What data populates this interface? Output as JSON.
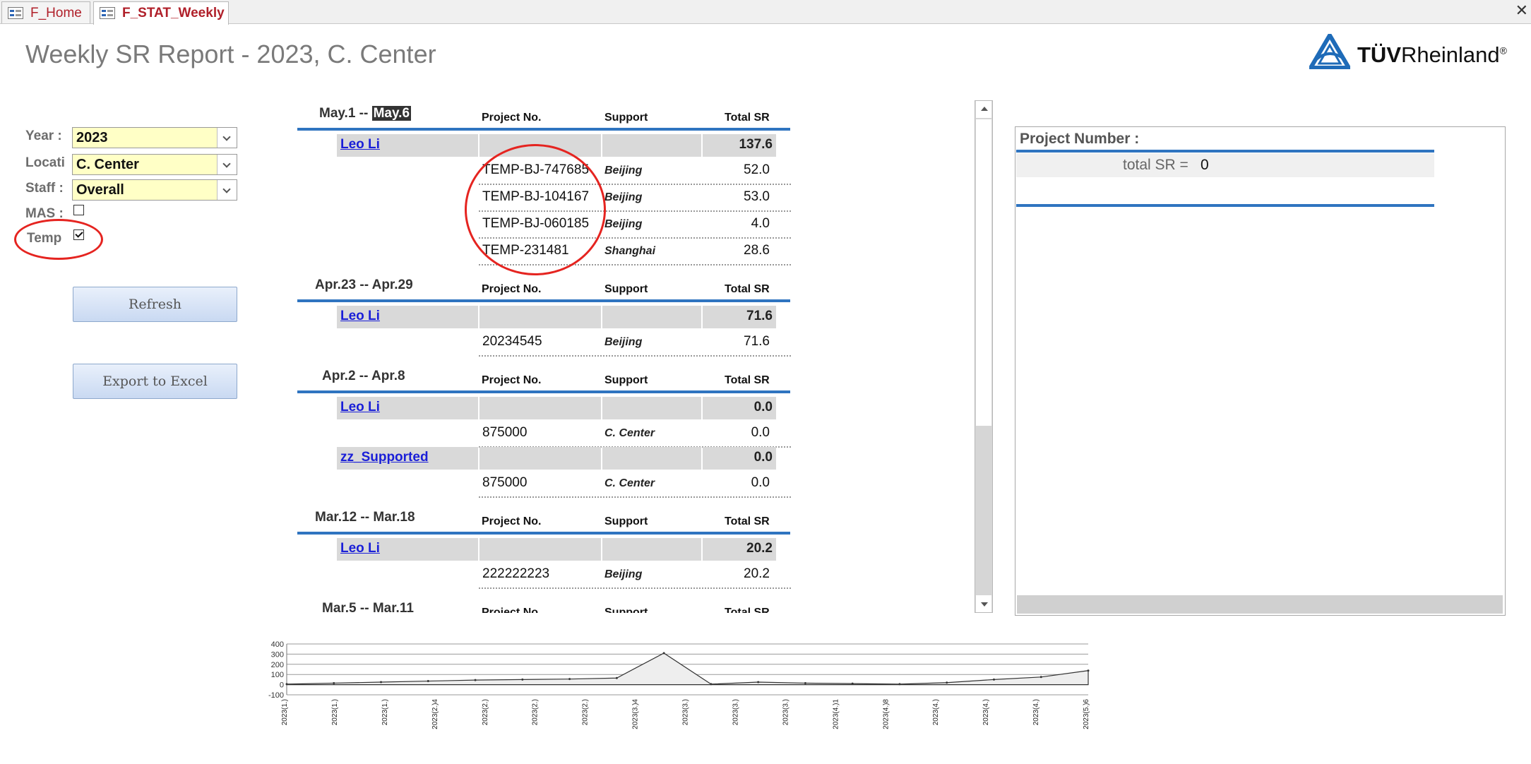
{
  "tabs": [
    {
      "label": "F_Home",
      "active": false
    },
    {
      "label": "F_STAT_Weekly",
      "active": true
    }
  ],
  "window": {
    "close_glyph": "✕"
  },
  "title": "Weekly SR Report - 2023, C. Center",
  "logo": {
    "text_bold": "TÜV",
    "text_regular": "Rheinland",
    "mark": "®",
    "icon": "tuv-triangle-icon"
  },
  "filters": {
    "year": {
      "label": "Year :",
      "value": "2023"
    },
    "location": {
      "label": "Locati",
      "value": "C. Center"
    },
    "staff": {
      "label": "Staff :",
      "value": "Overall"
    },
    "mas": {
      "label": "MAS :",
      "checked": false
    },
    "temp": {
      "label": "Temp",
      "checked": true
    }
  },
  "buttons": {
    "refresh": "Refresh",
    "export": "Export to Excel"
  },
  "report": {
    "columns": {
      "project": "Project No.",
      "support": "Support",
      "total": "Total SR"
    },
    "dash": "--",
    "weeks": [
      {
        "start": "May.1",
        "end": "May.6",
        "groups": [
          {
            "staff": "Leo Li",
            "total": "137.6",
            "rows": [
              {
                "project": "TEMP-BJ-747685",
                "support": "Beijing",
                "total": "52.0"
              },
              {
                "project": "TEMP-BJ-104167",
                "support": "Beijing",
                "total": "53.0"
              },
              {
                "project": "TEMP-BJ-060185",
                "support": "Beijing",
                "total": "4.0"
              },
              {
                "project": "TEMP-231481",
                "support": "Shanghai",
                "total": "28.6"
              }
            ]
          }
        ]
      },
      {
        "start": "Apr.23",
        "end": "Apr.29",
        "groups": [
          {
            "staff": "Leo Li",
            "total": "71.6",
            "rows": [
              {
                "project": "20234545",
                "support": "Beijing",
                "total": "71.6"
              }
            ]
          }
        ]
      },
      {
        "start": "Apr.2",
        "end": "Apr.8",
        "groups": [
          {
            "staff": "Leo Li",
            "total": "0.0",
            "rows": [
              {
                "project": "875000",
                "support": "C. Center",
                "total": "0.0"
              }
            ]
          },
          {
            "staff": "zz_Supported",
            "total": "0.0",
            "rows": [
              {
                "project": "875000",
                "support": "C. Center",
                "total": "0.0"
              }
            ]
          }
        ]
      },
      {
        "start": "Mar.12",
        "end": "Mar.18",
        "groups": [
          {
            "staff": "Leo Li",
            "total": "20.2",
            "rows": [
              {
                "project": "222222223",
                "support": "Beijing",
                "total": "20.2"
              }
            ]
          }
        ]
      },
      {
        "start": "Mar.5",
        "end": "Mar.11",
        "groups": []
      }
    ]
  },
  "detail": {
    "project_number_label": "Project Number :",
    "total_sr_label": "total SR =",
    "total_sr_value": "0"
  },
  "colors": {
    "accent_blue": "#2f74c0",
    "link": "#1a1fd8",
    "combo_bg": "#ffffc6",
    "annotation_red": "#e52420",
    "tab_text": "#b0202a"
  },
  "chart_data": {
    "type": "area",
    "ylim": [
      -100,
      400
    ],
    "yticks": [
      "400",
      "300",
      "200",
      "100",
      "0",
      "-100"
    ],
    "x": [
      "2023(1.)",
      "2023(1.)",
      "2023(1.)",
      "2023(2.)4",
      "2023(2.)",
      "2023(2.)",
      "2023(2.)",
      "2023(3.)4",
      "2023(3.)",
      "2023(3.)",
      "2023(3.)",
      "2023(4.)1",
      "2023(4.)8",
      "2023(4.)",
      "2023(4.)",
      "2023(4.)",
      "2023(5.)6"
    ],
    "values": [
      5,
      15,
      25,
      35,
      45,
      50,
      55,
      65,
      310,
      5,
      25,
      15,
      10,
      5,
      20,
      50,
      75,
      138
    ],
    "grid": true,
    "legend": "none"
  }
}
